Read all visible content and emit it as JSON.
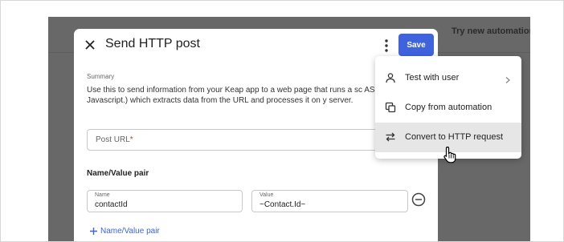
{
  "background": {
    "link_text": "Try new automation b"
  },
  "panel": {
    "title": "Send HTTP post",
    "save_label": "Save",
    "summary_label": "Summary",
    "summary_text": "Use this to send information from your Keap app to a web page that runs a sc ASP, PHP, Javascript.) which extracts data from the URL and processes it on y server.",
    "post_url_placeholder": "Post URL",
    "post_url_required": "*",
    "pairs_heading": "Name/Value pair",
    "name_field": {
      "label": "Name",
      "value": "contactId"
    },
    "value_field": {
      "label": "Value",
      "value": "~Contact.Id~"
    },
    "add_pair_label": "Name/Value pair"
  },
  "menu": {
    "items": [
      {
        "label": "Test with user",
        "icon": "person-icon",
        "has_submenu": true
      },
      {
        "label": "Copy from automation",
        "icon": "copy-icon",
        "has_submenu": false
      },
      {
        "label": "Convert to HTTP request",
        "icon": "swap-arrows-icon",
        "has_submenu": false,
        "highlighted": true
      }
    ]
  },
  "colors": {
    "accent": "#3e63dd",
    "overlay": "#686868",
    "required": "#d0342c",
    "highlight": "#e6e6e6"
  }
}
